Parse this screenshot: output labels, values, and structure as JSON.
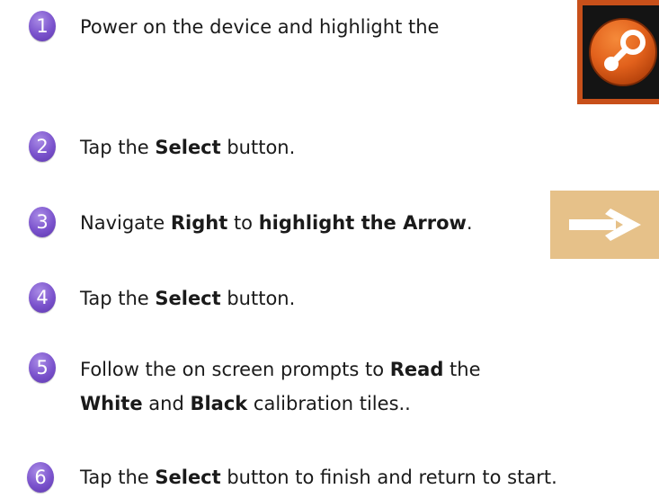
{
  "steps": [
    {
      "number": "1",
      "lines": [
        [
          {
            "text": "Power on the device and highlight the",
            "bold": false
          }
        ]
      ]
    },
    {
      "number": "2",
      "lines": [
        [
          {
            "text": "Tap the ",
            "bold": false
          },
          {
            "text": "Select",
            "bold": true
          },
          {
            "text": " button.",
            "bold": false
          }
        ]
      ]
    },
    {
      "number": "3",
      "lines": [
        [
          {
            "text": "Navigate ",
            "bold": false
          },
          {
            "text": "Right",
            "bold": true
          },
          {
            "text": " to ",
            "bold": false
          },
          {
            "text": "highlight the Arrow",
            "bold": true
          },
          {
            "text": ".",
            "bold": false
          }
        ]
      ]
    },
    {
      "number": "4",
      "lines": [
        [
          {
            "text": "Tap the ",
            "bold": false
          },
          {
            "text": "Select",
            "bold": true
          },
          {
            "text": " button.",
            "bold": false
          }
        ]
      ]
    },
    {
      "number": "5",
      "lines": [
        [
          {
            "text": "Follow the on screen prompts to ",
            "bold": false
          },
          {
            "text": "Read",
            "bold": true
          },
          {
            "text": " the",
            "bold": false
          }
        ],
        [
          {
            "text": "White",
            "bold": true
          },
          {
            "text": " and ",
            "bold": false
          },
          {
            "text": "Black",
            "bold": true
          },
          {
            "text": " calibration tiles..",
            "bold": false
          }
        ]
      ]
    },
    {
      "number": "6",
      "lines": [
        [
          {
            "text": "Tap the ",
            "bold": false
          },
          {
            "text": "Select",
            "bold": true
          },
          {
            "text": " button to finish and return to start.",
            "bold": false
          }
        ]
      ]
    }
  ],
  "icons": {
    "calibration_app_icon": "calibration-app-icon",
    "arrow_icon": "right-arrow-icon"
  },
  "colors": {
    "badge_purple": "#7a52cc",
    "app_icon_border": "#c8501a",
    "app_icon_orange": "#e2611c",
    "arrow_tile": "#e6c189",
    "text": "#1a1a1a"
  }
}
